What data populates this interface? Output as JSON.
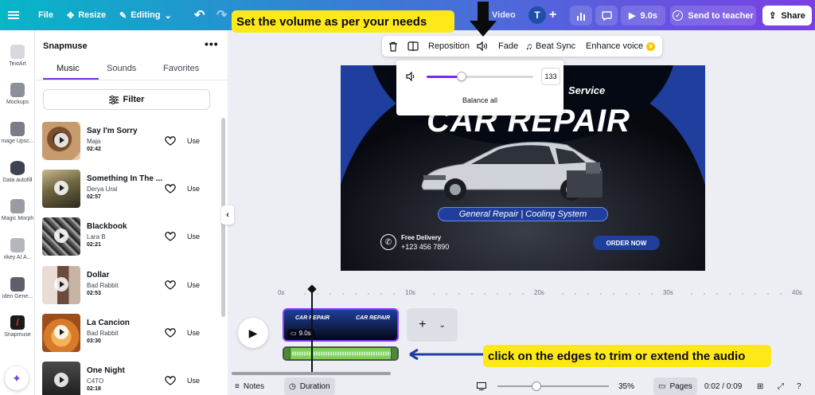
{
  "topbar": {
    "file": "File",
    "resize": "Resize",
    "editing": "Editing",
    "title_partial": "Video",
    "avatar": "T",
    "play_duration": "9.0s",
    "send_to_teacher": "Send to teacher",
    "share": "Share"
  },
  "annotations": {
    "volume_tip": "Set the volume as per your needs",
    "trim_tip": "click on the edges to trim or extend the audio"
  },
  "rail": {
    "items": [
      "TextArt",
      "Mockups",
      "mage Upsc...",
      "Data autofill",
      "Magic Morph",
      "rikey AI A...",
      "ideo Gene...",
      "Snapmuse"
    ]
  },
  "panel": {
    "title": "Snapmuse",
    "tabs": [
      "Music",
      "Sounds",
      "Favorites"
    ],
    "filter": "Filter",
    "use_label": "Use",
    "tracks": [
      {
        "name": "Say I'm Sorry",
        "artist": "Maja",
        "duration": "02:42"
      },
      {
        "name": "Something In The ...",
        "artist": "Derya Ural",
        "duration": "02:57"
      },
      {
        "name": "Blackbook",
        "artist": "Lara B",
        "duration": "02:21"
      },
      {
        "name": "Dollar",
        "artist": "Bad Rabbit",
        "duration": "02:53"
      },
      {
        "name": "La Cancion",
        "artist": "Bad Rabbit",
        "duration": "03:30"
      },
      {
        "name": "One Night",
        "artist": "C4TO",
        "duration": "02:18"
      }
    ]
  },
  "toolbar": {
    "reposition": "Reposition",
    "fade": "Fade",
    "beat_sync": "Beat Sync",
    "enhance_voice": "Enhance voice"
  },
  "volume": {
    "value": "133",
    "level": 0.33,
    "balance_all": "Balance all"
  },
  "design": {
    "service": "Service",
    "headline": "CAR REPAIR",
    "subtitle": "General Repair | Cooling System",
    "delivery_label": "Free Delivery",
    "phone": "+123 456 7890",
    "order": "ORDER NOW"
  },
  "timeline": {
    "ticks": [
      "0s",
      "10s",
      "20s",
      "30s",
      "40s"
    ],
    "clip_duration": "9.0s",
    "clip_text": "CAR REPAIR"
  },
  "bottombar": {
    "notes": "Notes",
    "duration": "Duration",
    "zoom": "35%",
    "pages": "Pages",
    "time": "0:02 / 0:09",
    "zoom_level": 0.35
  }
}
